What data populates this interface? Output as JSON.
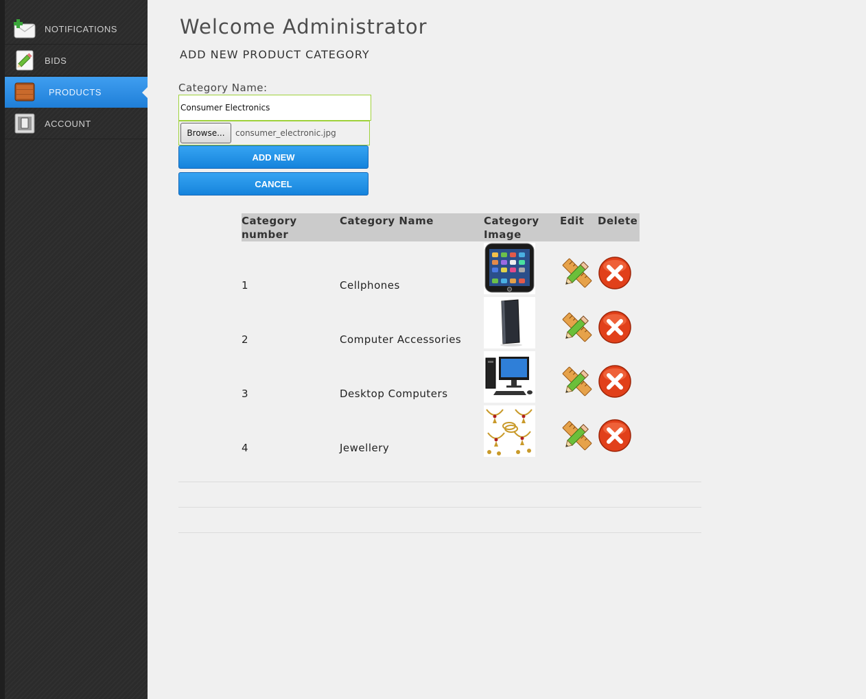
{
  "sidebar": {
    "items": [
      {
        "label": "NOTIFICATIONS",
        "icon": "notifications-icon",
        "active": false
      },
      {
        "label": "BIDS",
        "icon": "bids-icon",
        "active": false
      },
      {
        "label": "PRODUCTS",
        "icon": "products-icon",
        "active": true
      },
      {
        "label": "ACCOUNT",
        "icon": "account-icon",
        "active": false
      }
    ]
  },
  "header": {
    "title": "Welcome Administrator",
    "section": "ADD NEW PRODUCT CATEGORY"
  },
  "form": {
    "category_label": "Category Name:",
    "category_value": "Consumer Electronics",
    "browse_label": "Browse...",
    "file_name": "consumer_electronic.jpg",
    "add_label": "ADD NEW",
    "cancel_label": "CANCEL"
  },
  "table": {
    "headers": {
      "number": "Category number",
      "name": "Category Name",
      "image": "Category Image",
      "edit": "Edit",
      "delete": "Delete"
    },
    "rows": [
      {
        "number": "1",
        "name": "Cellphones",
        "image_icon": "cellphone-icon"
      },
      {
        "number": "2",
        "name": "Computer Accessories",
        "image_icon": "external-drive-icon"
      },
      {
        "number": "3",
        "name": "Desktop Computers",
        "image_icon": "desktop-computer-icon"
      },
      {
        "number": "4",
        "name": "Jewellery",
        "image_icon": "jewellery-icon"
      }
    ]
  },
  "colors": {
    "accent": "#1f86dc",
    "sidebar_bg": "#2b2b2b",
    "input_border": "#9ed13a",
    "delete_red": "#e1401a"
  }
}
